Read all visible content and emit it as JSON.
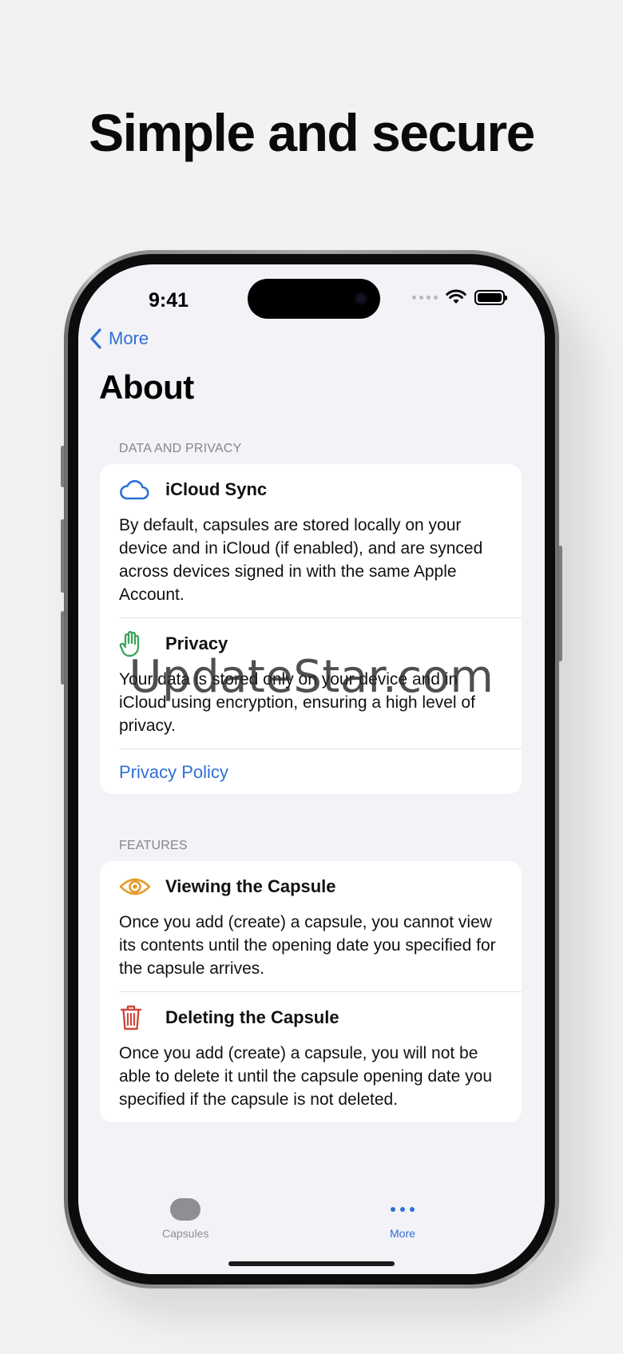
{
  "headline": "Simple and secure",
  "status": {
    "time": "9:41"
  },
  "nav": {
    "back_label": "More"
  },
  "page": {
    "title": "About"
  },
  "sections": [
    {
      "header": "DATA AND PRIVACY",
      "items": [
        {
          "title": "iCloud Sync",
          "icon": "cloud-icon",
          "icon_color": "#2f6fd6",
          "body": "By default, capsules are stored locally on your device and in iCloud (if enabled), and are synced across devices signed in with the same Apple Account."
        },
        {
          "title": "Privacy",
          "icon": "hand-icon",
          "icon_color": "#3ca35a",
          "body": "Your data is stored only on your device and in iCloud using encryption, ensuring a high level of privacy."
        }
      ],
      "link": "Privacy Policy"
    },
    {
      "header": "FEATURES",
      "items": [
        {
          "title": "Viewing the Capsule",
          "icon": "eye-icon",
          "icon_color": "#e39a2a",
          "body": "Once you add (create) a capsule, you cannot view its contents until the opening date you specified for the capsule arrives."
        },
        {
          "title": "Deleting the Capsule",
          "icon": "trash-icon",
          "icon_color": "#d2483f",
          "body": "Once you add (create) a capsule, you will not be able to delete it until the capsule opening date you specified if the capsule is not deleted."
        }
      ]
    }
  ],
  "tabs": [
    {
      "label": "Capsules",
      "icon": "capsule-icon",
      "active": false
    },
    {
      "label": "More",
      "icon": "ellipsis-icon",
      "active": true
    }
  ],
  "watermark": "UpdateStar.com",
  "colors": {
    "accent": "#2f6fd6",
    "tab_inactive": "#8e8e93",
    "background": "#f2f2f7"
  }
}
